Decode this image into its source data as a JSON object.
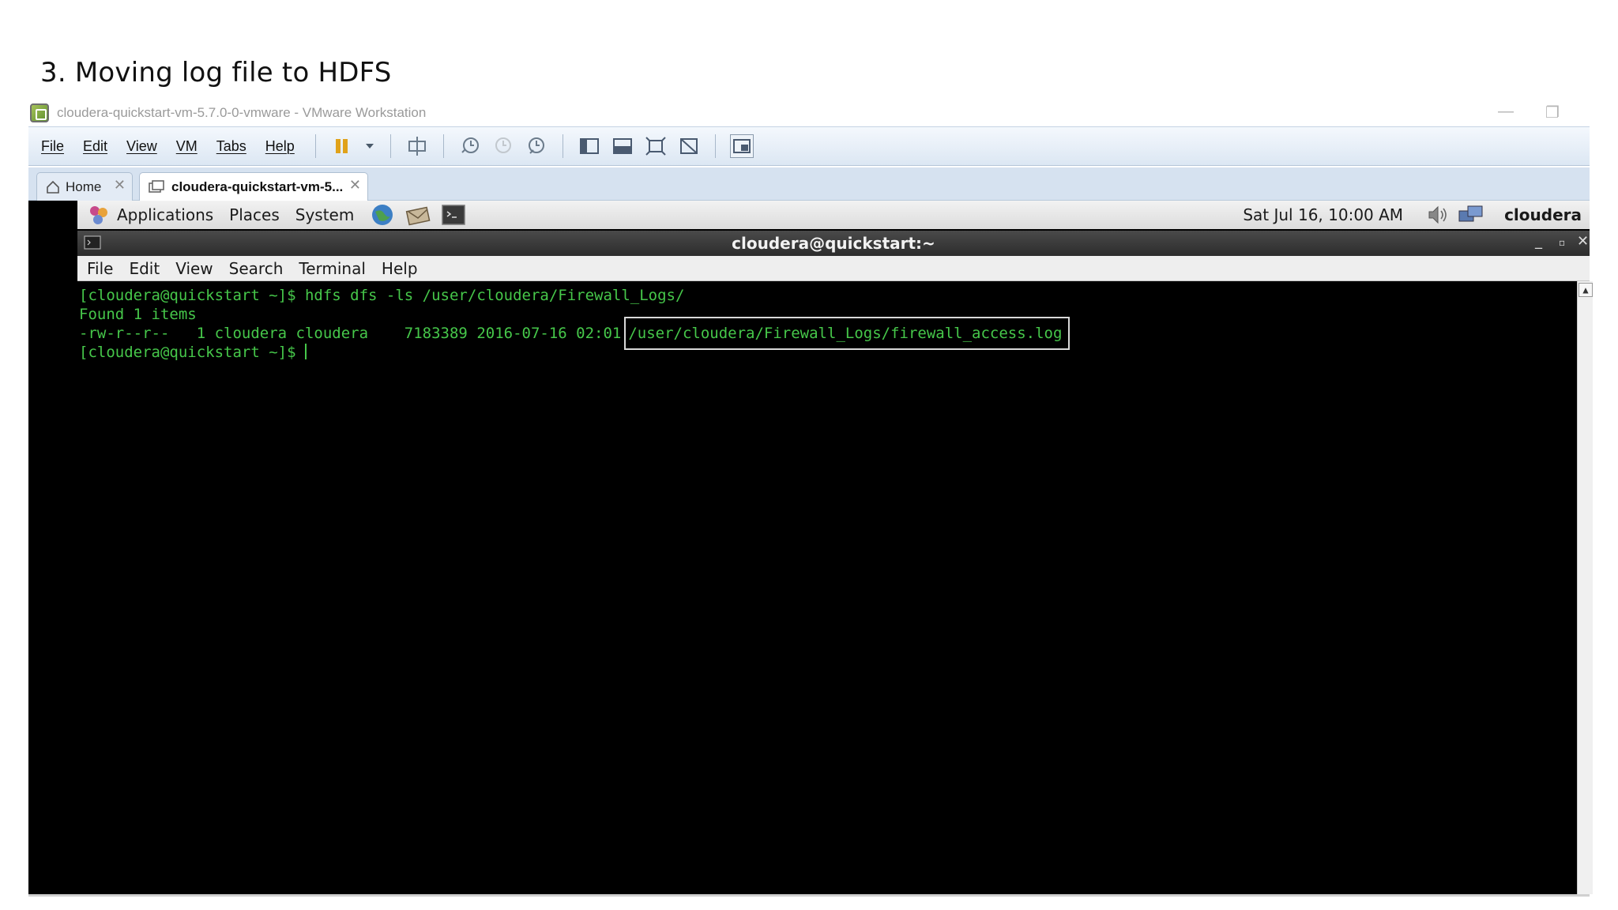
{
  "slide": {
    "title": "3. Moving log file to HDFS"
  },
  "vmware": {
    "window_title": "cloudera-quickstart-vm-5.7.0-0-vmware - VMware Workstation",
    "menu": [
      "File",
      "Edit",
      "View",
      "VM",
      "Tabs",
      "Help"
    ],
    "tabs": [
      {
        "label": "Home"
      },
      {
        "label": "cloudera-quickstart-vm-5..."
      }
    ]
  },
  "gnome_panel": {
    "menus": [
      "Applications",
      "Places",
      "System"
    ],
    "datetime": "Sat Jul 16, 10:00 AM",
    "user": "cloudera"
  },
  "terminal": {
    "title": "cloudera@quickstart:~",
    "menu": [
      "File",
      "Edit",
      "View",
      "Search",
      "Terminal",
      "Help"
    ],
    "lines": {
      "cmd": "[cloudera@quickstart ~]$ hdfs dfs -ls /user/cloudera/Firewall_Logs/",
      "found": "Found 1 items",
      "entry_meta": "-rw-r--r--   1 cloudera cloudera    7183389 2016-07-16 02:01",
      "entry_path": "/user/cloudera/Firewall_Logs/firewall_access.log",
      "prompt": "[cloudera@quickstart ~]$ "
    },
    "text_color": "#46c74a"
  }
}
